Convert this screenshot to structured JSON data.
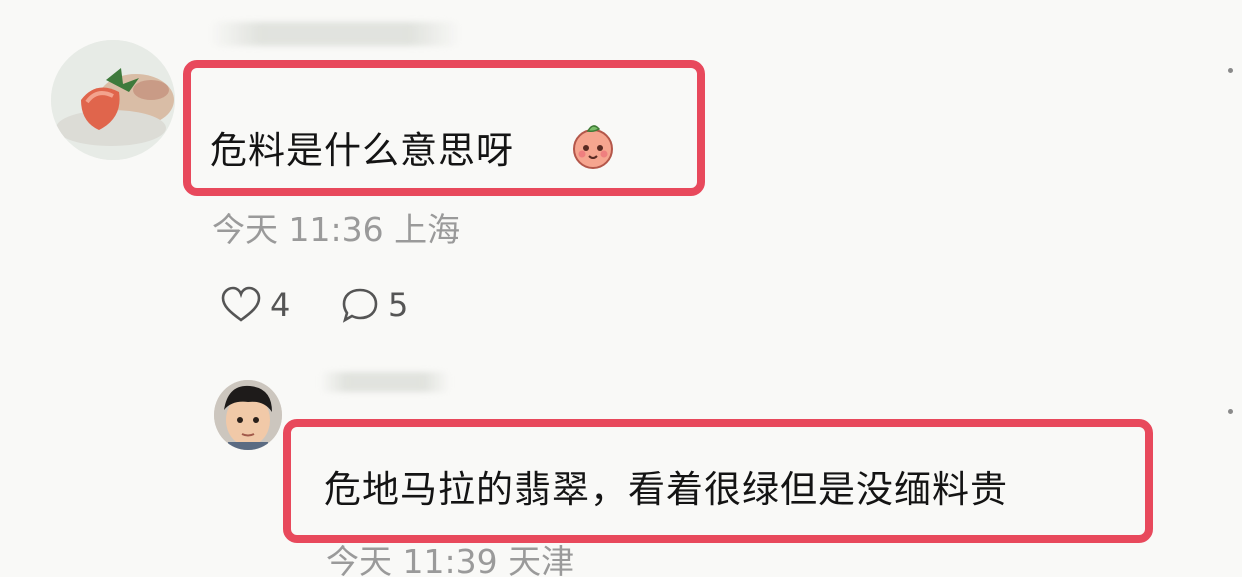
{
  "comment": {
    "text": "危料是什么意思呀",
    "emoji": "peach-emoji-icon",
    "time_location": "今天 11:36 上海",
    "likes": "4",
    "replies": "5"
  },
  "reply": {
    "text": "危地马拉的翡翠，看着很绿但是没缅料贵",
    "time_location": "今天 11:39 天津"
  },
  "colors": {
    "highlight": "#e8495c",
    "meta_text": "#9a9a9a",
    "body_text": "#141414",
    "background": "#f9f9f7"
  }
}
